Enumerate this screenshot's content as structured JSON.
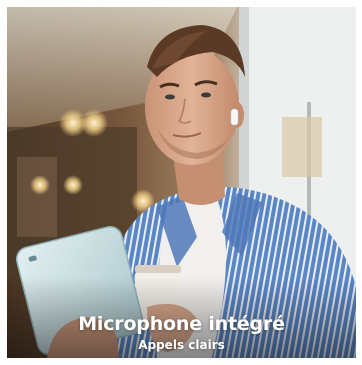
{
  "caption": {
    "title": "Microphone intégré",
    "subtitle": "Appels clairs"
  },
  "colors": {
    "shirt_blue": "#5b86c4",
    "shirt_stripe": "#e8eef7",
    "tshirt_white": "#f2f0ee",
    "skin": "#d9a98c",
    "hair": "#5a3a24",
    "phone": "#cfe3e6",
    "background_warm": "#6b4e36",
    "background_light": "#e9ecea",
    "caption_text": "#ffffff"
  }
}
